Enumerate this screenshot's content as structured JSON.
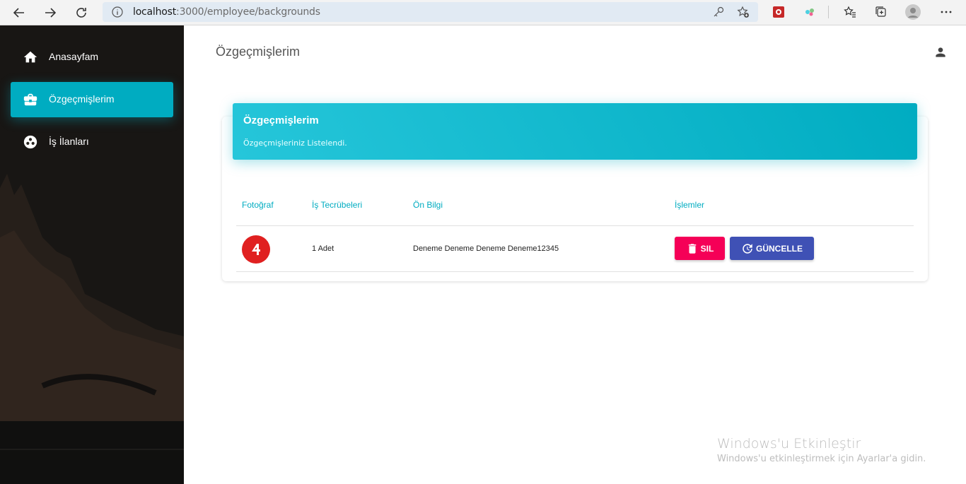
{
  "browser": {
    "url_host": "localhost",
    "url_path": ":3000/employee/backgrounds"
  },
  "sidebar": {
    "items": [
      {
        "label": "Anasayfam",
        "icon": "home-icon",
        "active": false
      },
      {
        "label": "Özgeçmişlerim",
        "icon": "briefcase-icon",
        "active": true
      },
      {
        "label": "İş İlanları",
        "icon": "bubble-chart-icon",
        "active": false
      }
    ]
  },
  "header": {
    "title": "Özgeçmişlerim"
  },
  "card": {
    "title": "Özgeçmişlerim",
    "subtitle": "Özgeçmişleriniz Listelendi.",
    "columns": [
      "Fotoğraf",
      "İş Tecrübeleri",
      "Ön Bilgi",
      "İşlemler"
    ],
    "rows": [
      {
        "experiences": "1 Adet",
        "info": "Deneme Deneme Deneme Deneme12345"
      }
    ],
    "delete_label": "SIL",
    "update_label": "GÜNCELLE"
  },
  "watermark": {
    "title": "Windows'u Etkinleştir",
    "subtitle": "Windows'u etkinleştirmek için Ayarlar'a gidin."
  },
  "colors": {
    "accent": "#00acc1",
    "delete": "#f50057",
    "update": "#3f51b5"
  }
}
